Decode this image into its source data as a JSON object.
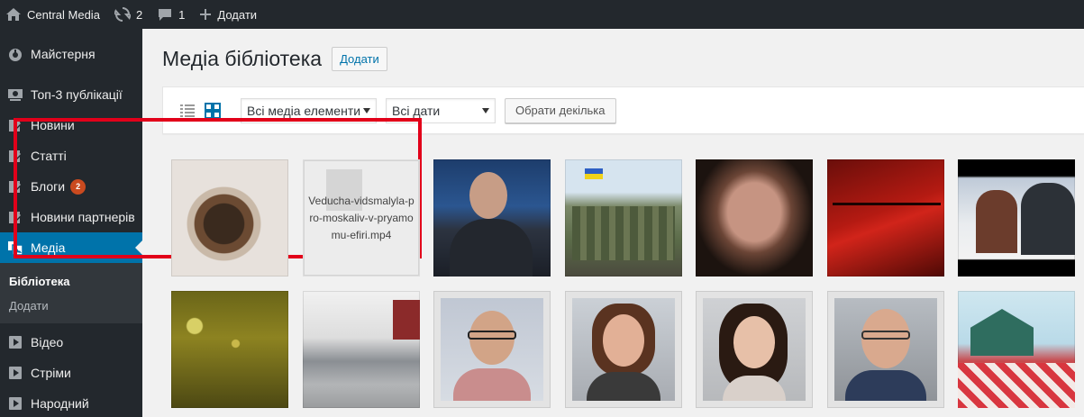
{
  "adminbar": {
    "site_name": "Central Media",
    "updates_count": "2",
    "comments_count": "1",
    "new_label": "Додати"
  },
  "sidebar": {
    "items": [
      {
        "label": "Майстерня",
        "icon": "dashboard-icon"
      },
      {
        "label": "Топ-3 публікації",
        "icon": "screen-icon"
      },
      {
        "label": "Новини",
        "icon": "edit-icon"
      },
      {
        "label": "Статті",
        "icon": "edit-icon"
      },
      {
        "label": "Блоги",
        "icon": "edit-icon",
        "badge": "2"
      },
      {
        "label": "Новини партнерів",
        "icon": "edit-icon"
      },
      {
        "label": "Медіа",
        "icon": "media-icon"
      },
      {
        "label": "Відео",
        "icon": "video-icon"
      },
      {
        "label": "Стріми",
        "icon": "video-icon"
      },
      {
        "label": "Народний",
        "icon": "video-icon"
      }
    ],
    "submenu": {
      "library": "Бібліотека",
      "add": "Додати"
    }
  },
  "main": {
    "title": "Медіа бібліотека",
    "add_button": "Додати",
    "filters": {
      "media_type": "Всі медіа елементи",
      "dates": "Всі дати",
      "bulk_select": "Обрати декілька"
    },
    "file_item": {
      "filename": "Veducha-vidsmalyla-pro-moskaliv-v-pryamomu-efiri.mp4"
    }
  },
  "colors": {
    "admin_bg": "#23282d",
    "accent": "#0073aa",
    "highlight": "#e2001a",
    "badge": "#ca4a1f"
  }
}
